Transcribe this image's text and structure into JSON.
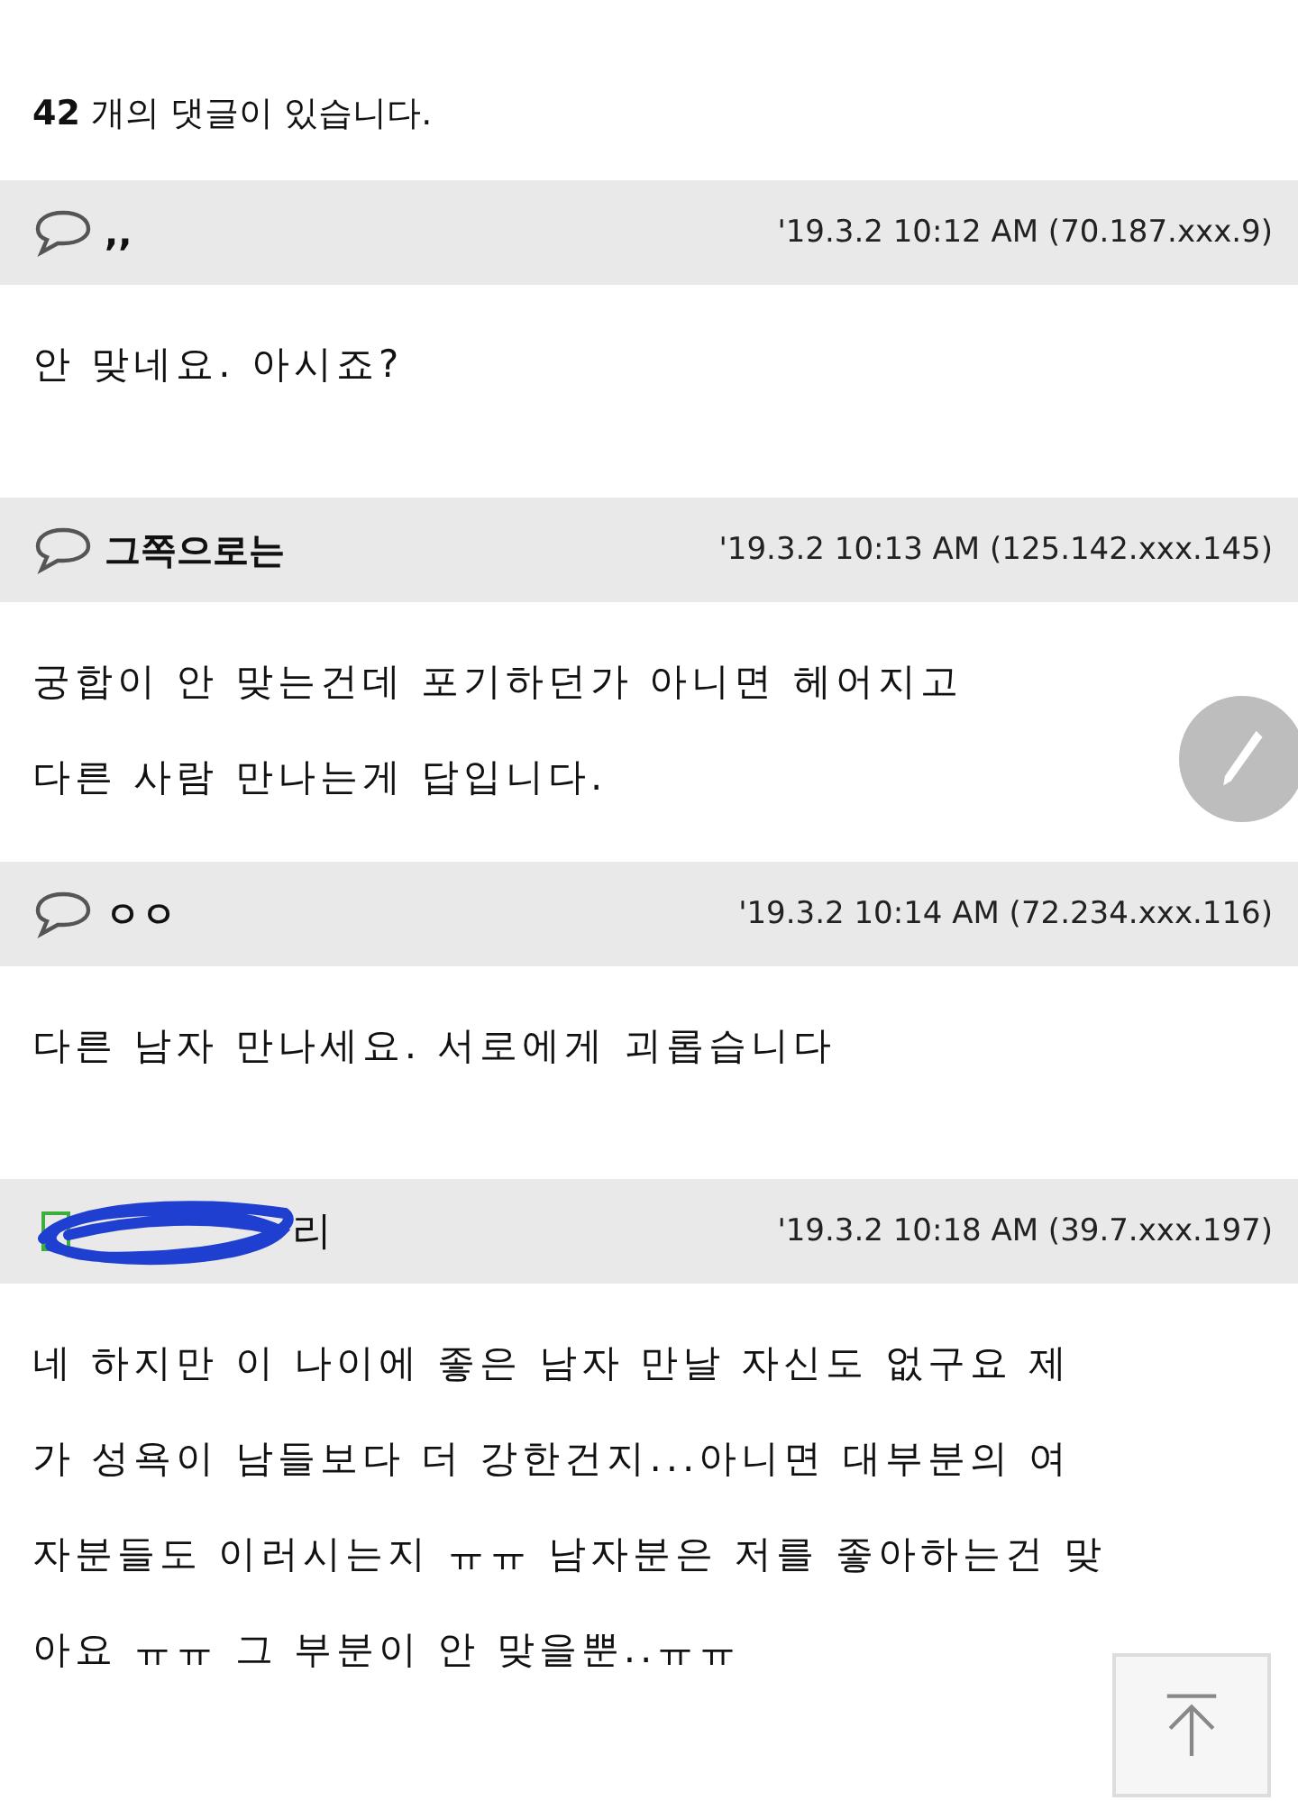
{
  "comment_count": "**42** 개의 댓글이 있습니다.",
  "comments": [
    {
      "author": ",,",
      "redacted": false,
      "meta": "'19.3.2 10:12 AM (70.187.xxx.9)",
      "body": "안 맞네요. 아시죠?"
    },
    {
      "author": "그쪽으로는",
      "redacted": false,
      "meta": "'19.3.2 10:13 AM (125.142.xxx.145)",
      "body": "궁합이 안 맞는건데 포기하던가 아니면 헤어지고\n다른 사람 만나는게 답입니다."
    },
    {
      "author": "ㅇㅇ",
      "redacted": false,
      "meta": "'19.3.2 10:14 AM (72.234.xxx.116)",
      "body": "다른 남자 만나세요. 서로에게 괴롭습니다"
    },
    {
      "author": "리",
      "redacted": true,
      "meta": "'19.3.2 10:18 AM (39.7.xxx.197)",
      "body": "네 하지만 이 나이에 좋은 남자 만날 자신도 없구요 제\n가 성욕이 남들보다 더 강한건지...아니면 대부분의 여\n자분들도 이러시는지 ㅠㅠ 남자분은 저를 좋아하는건 맞\n아요 ㅠㅠ 그 부분이 안 맞을뿐..ㅠㅠ"
    }
  ]
}
